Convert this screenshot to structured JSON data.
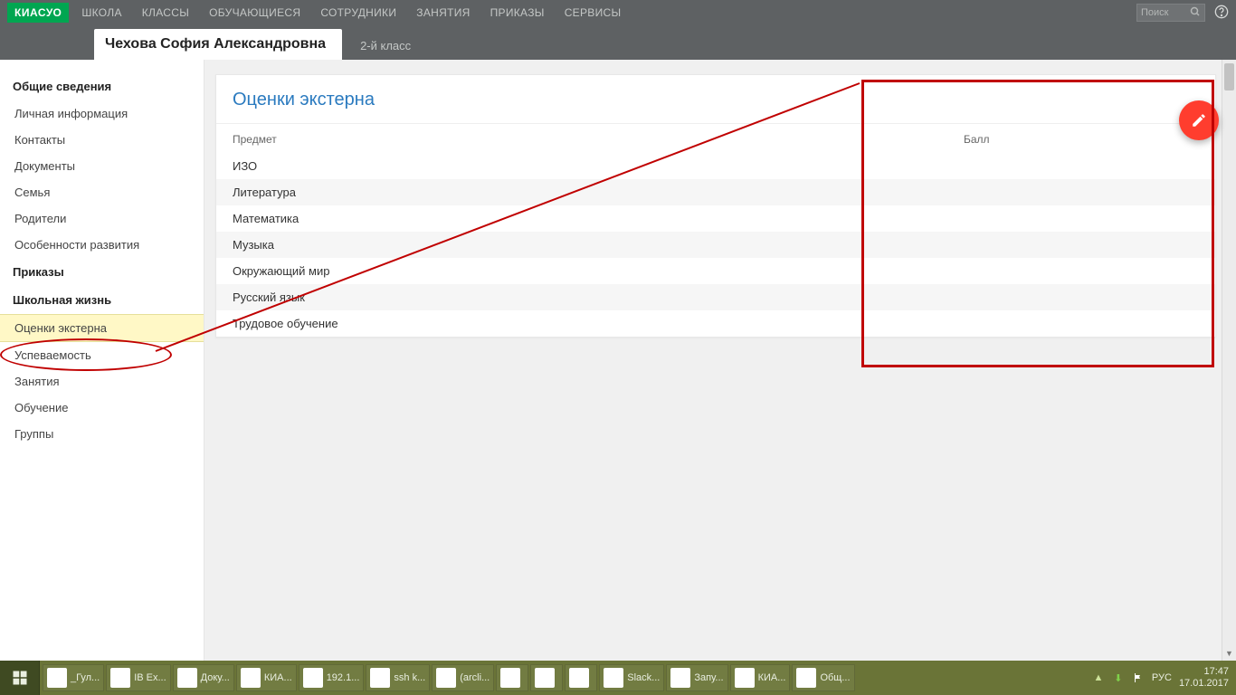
{
  "navbar": {
    "logo": "КИАСУО",
    "items": [
      "ШКОЛА",
      "КЛАССЫ",
      "ОБУЧАЮЩИЕСЯ",
      "СОТРУДНИКИ",
      "ЗАНЯТИЯ",
      "ПРИКАЗЫ",
      "СЕРВИСЫ"
    ],
    "search_placeholder": "Поиск"
  },
  "subbar": {
    "student_name": "Чехова София Александровна",
    "class_label": "2-й класс"
  },
  "sidebar": {
    "groups": [
      {
        "title": "Общие сведения",
        "items": [
          "Личная информация",
          "Контакты",
          "Документы",
          "Семья",
          "Родители",
          "Особенности развития"
        ]
      },
      {
        "title": "Приказы",
        "items": []
      },
      {
        "title": "Школьная жизнь",
        "items": [
          "Оценки экстерна",
          "Успеваемость",
          "Занятия",
          "Обучение",
          "Группы"
        ]
      }
    ],
    "active_item": "Оценки экстерна"
  },
  "main": {
    "title": "Оценки экстерна",
    "col_subject": "Предмет",
    "col_score": "Балл",
    "rows": [
      "ИЗО",
      "Литература",
      "Математика",
      "Музыка",
      "Окружающий мир",
      "Русский язык",
      "Трудовое обучение"
    ]
  },
  "taskbar": {
    "items": [
      {
        "label": "_Гул...",
        "icon": "orange"
      },
      {
        "label": "IB Ex...",
        "icon": "green"
      },
      {
        "label": "Доку...",
        "icon": "blue"
      },
      {
        "label": "КИА...",
        "icon": "ff"
      },
      {
        "label": "192.1...",
        "icon": "dark"
      },
      {
        "label": "ssh k...",
        "icon": "navy"
      },
      {
        "label": "(arcli...",
        "icon": "navy"
      },
      {
        "label": "",
        "icon": "xl"
      },
      {
        "label": "",
        "icon": "folder"
      },
      {
        "label": "",
        "icon": "chrome"
      },
      {
        "label": "Slack...",
        "icon": "slack"
      },
      {
        "label": "Запу...",
        "icon": "ki"
      },
      {
        "label": "КИА...",
        "icon": "pal"
      },
      {
        "label": "Общ...",
        "icon": "pal2"
      }
    ],
    "lang": "РУС",
    "time": "17:47",
    "date": "17.01.2017"
  }
}
